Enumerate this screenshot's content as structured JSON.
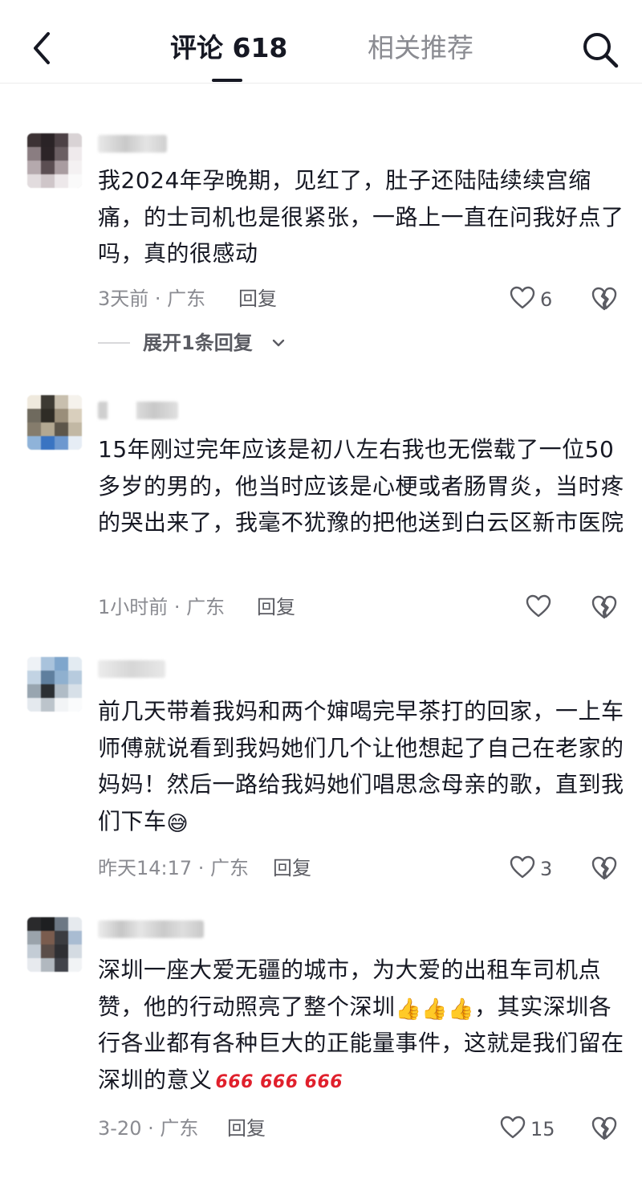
{
  "header": {
    "tab_comments": "评论 618",
    "tab_related": "相关推荐"
  },
  "icons": {
    "back": "back-arrow-icon",
    "search": "search-icon",
    "like": "heart-icon",
    "dislike": "broken-heart-icon",
    "chevron": "chevron-down-icon"
  },
  "colors": {
    "text_primary": "#161823",
    "text_secondary": "#8a8b91"
  },
  "comments": [
    {
      "text": "我2024年孕晚期，见红了，肚子还陆陆续续宫缩痛，的士司机也是很紧张，一路上一直在问我好点了吗，真的很感动",
      "meta": "3天前 · 广东",
      "reply": "回复",
      "likes": "6",
      "expand": "展开1条回复"
    },
    {
      "text": "15年刚过完年应该是初八左右我也无偿载了一位50多岁的男的，他当时应该是心梗或者肠胃炎，当时疼的哭出来了，我毫不犹豫的把他送到白云区新市医院",
      "meta": "1小时前 · 广东",
      "reply": "回复",
      "likes": ""
    },
    {
      "text": "前几天带着我妈和两个婶喝完早茶打的回家，一上车师傅就说看到我妈她们几个让他想起了自己在老家的妈妈！然后一路给我妈她们唱思念母亲的歌，直到我们下车",
      "emoji": "😅",
      "meta": "昨天14:17 · 广东",
      "reply": "回复",
      "likes": "3"
    },
    {
      "text_a": "深圳一座大爱无疆的城市，为大爱的出租车司机点赞，他的行动照亮了整个深圳",
      "emoji_a": "👍👍👍",
      "text_b": "，其实深圳各行各业都有各种巨大的正能量事件，这就是我们留在深圳的意义",
      "emoji_b": "666 666 666",
      "meta": "3-20 · 广东",
      "reply": "回复",
      "likes": "15"
    }
  ]
}
